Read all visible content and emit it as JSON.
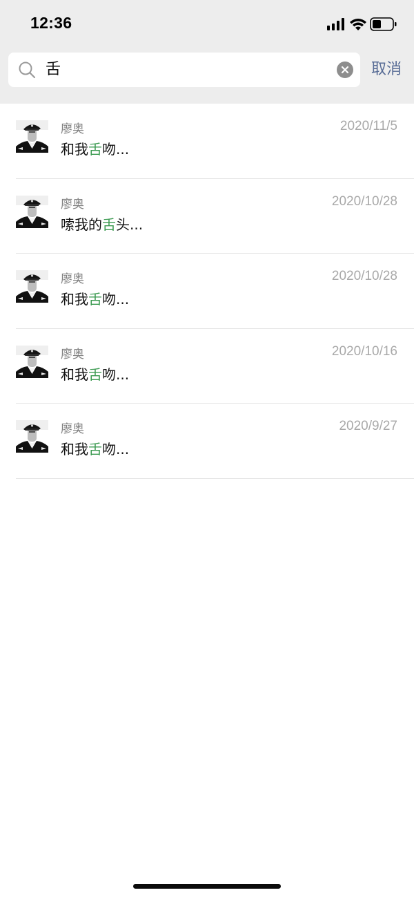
{
  "status_bar": {
    "time": "12:36"
  },
  "search": {
    "query": "舌",
    "cancel_label": "取消"
  },
  "results": [
    {
      "sender": "廖奥",
      "date": "2020/11/5",
      "prefix": "和我",
      "highlight": "舌",
      "suffix": "吻..."
    },
    {
      "sender": "廖奥",
      "date": "2020/10/28",
      "prefix": "嗦我的",
      "highlight": "舌",
      "suffix": "头..."
    },
    {
      "sender": "廖奥",
      "date": "2020/10/28",
      "prefix": "和我",
      "highlight": "舌",
      "suffix": "吻..."
    },
    {
      "sender": "廖奥",
      "date": "2020/10/16",
      "prefix": "和我",
      "highlight": "舌",
      "suffix": "吻..."
    },
    {
      "sender": "廖奥",
      "date": "2020/9/27",
      "prefix": "和我",
      "highlight": "舌",
      "suffix": "吻..."
    }
  ],
  "colors": {
    "highlight": "#3d9b52",
    "cancel": "#576b95",
    "header_bg": "#ededed"
  }
}
